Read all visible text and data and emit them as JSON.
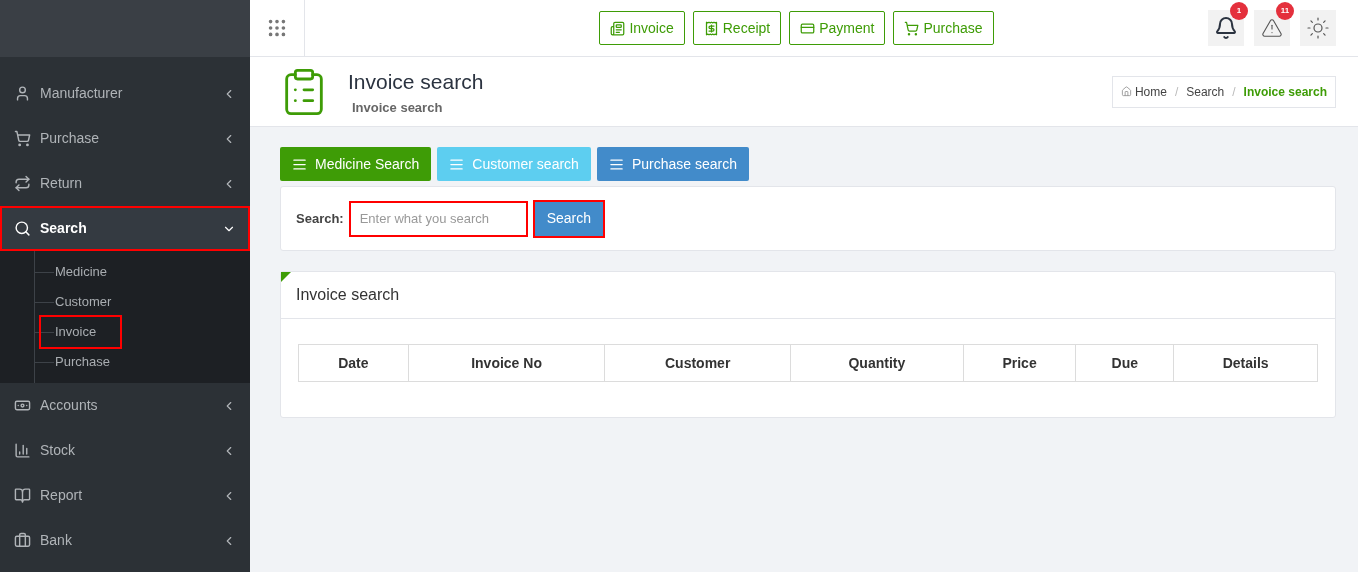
{
  "sidebar": {
    "items": [
      {
        "label": "Manufacturer",
        "expanded": false,
        "highlighted": false
      },
      {
        "label": "Purchase",
        "expanded": false,
        "highlighted": false
      },
      {
        "label": "Return",
        "expanded": false,
        "highlighted": false
      },
      {
        "label": "Search",
        "expanded": true,
        "highlighted": true,
        "children": [
          {
            "label": "Medicine",
            "highlighted": false
          },
          {
            "label": "Customer",
            "highlighted": false
          },
          {
            "label": "Invoice",
            "highlighted": true
          },
          {
            "label": "Purchase",
            "highlighted": false
          }
        ]
      },
      {
        "label": "Accounts",
        "expanded": false,
        "highlighted": false
      },
      {
        "label": "Stock",
        "expanded": false,
        "highlighted": false
      },
      {
        "label": "Report",
        "expanded": false,
        "highlighted": false
      },
      {
        "label": "Bank",
        "expanded": false,
        "highlighted": false
      }
    ]
  },
  "topbar": {
    "quick_buttons": [
      "Invoice",
      "Receipt",
      "Payment",
      "Purchase"
    ],
    "notifications": "1",
    "alerts": "11"
  },
  "page_header": {
    "title": "Invoice search",
    "subtitle": "Invoice search",
    "breadcrumb": [
      {
        "label": "Home"
      },
      {
        "separator": "/",
        "label": "Search"
      },
      {
        "separator": "/",
        "label": "Invoice search"
      }
    ]
  },
  "search_tabs": [
    {
      "label": "Medicine Search",
      "color": "#3e9c06"
    },
    {
      "label": "Customer search",
      "color": "#5dcef0"
    },
    {
      "label": "Purchase search",
      "color": "#428bca"
    }
  ],
  "search_form": {
    "label": "Search:",
    "placeholder": "Enter what you search",
    "field_highlighted": true,
    "button": "Search",
    "button_highlighted": true
  },
  "results": {
    "title": "Invoice search",
    "columns": [
      "Date",
      "Invoice No",
      "Customer",
      "Quantity",
      "Price",
      "Due",
      "Details"
    ]
  }
}
